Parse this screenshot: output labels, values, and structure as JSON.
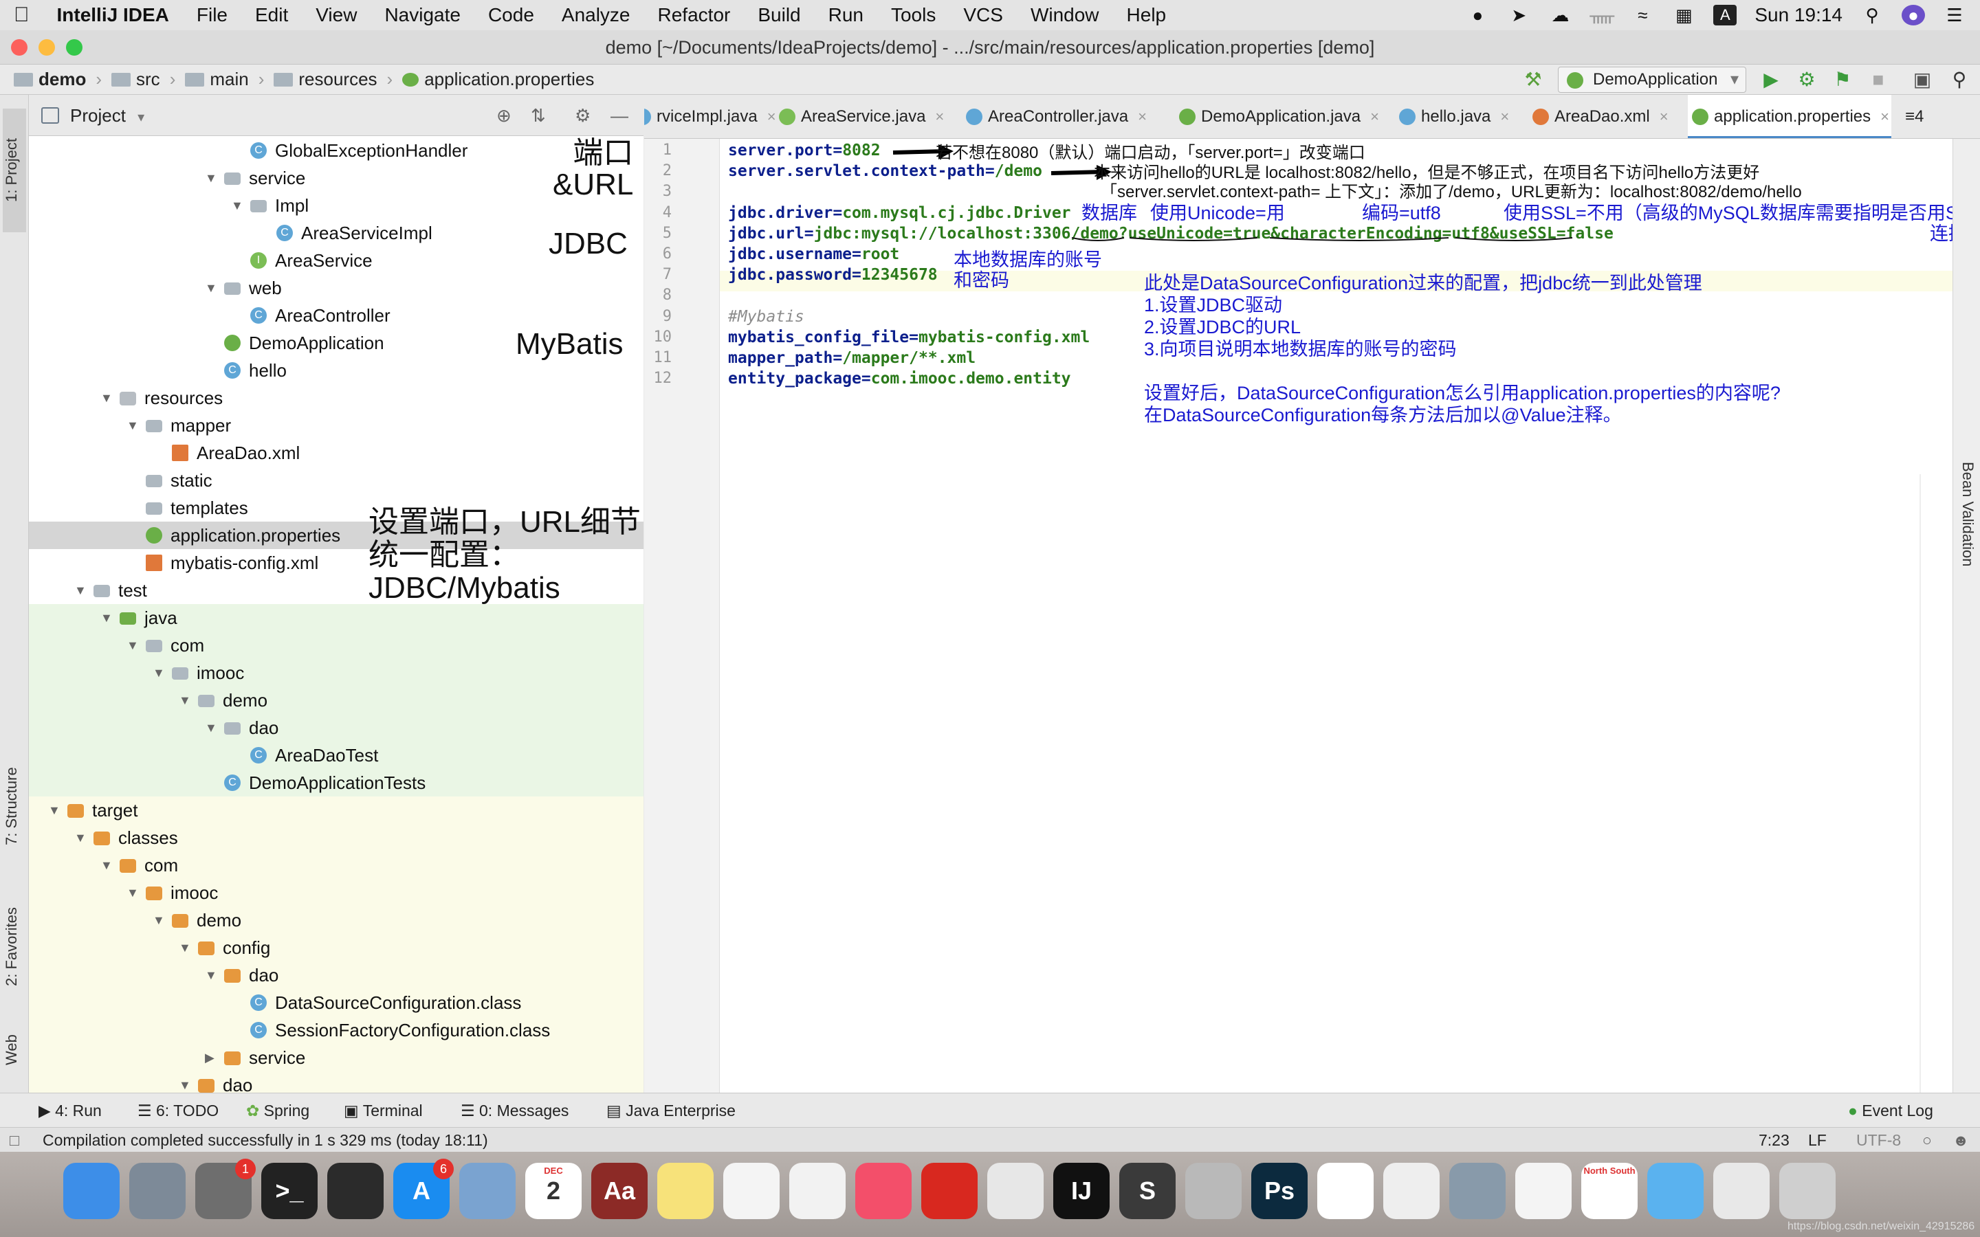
{
  "menubar": {
    "app": "IntelliJ IDEA",
    "items": [
      "File",
      "Edit",
      "View",
      "Navigate",
      "Code",
      "Analyze",
      "Refactor",
      "Build",
      "Run",
      "Tools",
      "VCS",
      "Window",
      "Help"
    ],
    "clock": "Sun 19:14",
    "input_source": "A"
  },
  "window": {
    "title": "demo [~/Documents/IdeaProjects/demo] - .../src/main/resources/application.properties [demo]"
  },
  "breadcrumb": [
    "demo",
    "src",
    "main",
    "resources",
    "application.properties"
  ],
  "run_config": "DemoApplication",
  "left_stripe": [
    "1: Project",
    "7: Structure",
    "2: Favorites",
    "Web"
  ],
  "project_panel": {
    "title": "Project"
  },
  "tree": [
    {
      "label": "GlobalExceptionHandler",
      "icon": "class-icon",
      "indent": 8,
      "arrow": ""
    },
    {
      "label": "service",
      "icon": "package-icon",
      "indent": 7,
      "arrow": "▼"
    },
    {
      "label": "Impl",
      "icon": "package-icon",
      "indent": 8,
      "arrow": "▼"
    },
    {
      "label": "AreaServiceImpl",
      "icon": "class-icon",
      "indent": 9,
      "arrow": ""
    },
    {
      "label": "AreaService",
      "icon": "interface-icon",
      "indent": 8,
      "arrow": ""
    },
    {
      "label": "web",
      "icon": "package-icon",
      "indent": 7,
      "arrow": "▼"
    },
    {
      "label": "AreaController",
      "icon": "class-icon",
      "indent": 8,
      "arrow": ""
    },
    {
      "label": "DemoApplication",
      "icon": "spring-class-icon",
      "indent": 7,
      "arrow": ""
    },
    {
      "label": "hello",
      "icon": "class-icon",
      "indent": 7,
      "arrow": ""
    },
    {
      "label": "resources",
      "icon": "resources-folder-icon",
      "indent": 3,
      "arrow": "▼"
    },
    {
      "label": "mapper",
      "icon": "package-icon",
      "indent": 4,
      "arrow": "▼"
    },
    {
      "label": "AreaDao.xml",
      "icon": "xml-file-icon",
      "indent": 5,
      "arrow": ""
    },
    {
      "label": "static",
      "icon": "package-icon",
      "indent": 4,
      "arrow": ""
    },
    {
      "label": "templates",
      "icon": "package-icon",
      "indent": 4,
      "arrow": ""
    },
    {
      "label": "application.properties",
      "icon": "spring-properties-icon",
      "indent": 4,
      "arrow": "",
      "state": "selected"
    },
    {
      "label": "mybatis-config.xml",
      "icon": "xml-file-icon",
      "indent": 4,
      "arrow": ""
    },
    {
      "label": "test",
      "icon": "package-icon",
      "indent": 2,
      "arrow": "▼"
    },
    {
      "label": "java",
      "icon": "green-folder-icon",
      "indent": 3,
      "arrow": "▼",
      "state": "test"
    },
    {
      "label": "com",
      "icon": "package-icon",
      "indent": 4,
      "arrow": "▼",
      "state": "test"
    },
    {
      "label": "imooc",
      "icon": "package-icon",
      "indent": 5,
      "arrow": "▼",
      "state": "test"
    },
    {
      "label": "demo",
      "icon": "package-icon",
      "indent": 6,
      "arrow": "▼",
      "state": "test"
    },
    {
      "label": "dao",
      "icon": "package-icon",
      "indent": 7,
      "arrow": "▼",
      "state": "test"
    },
    {
      "label": "AreaDaoTest",
      "icon": "class-icon",
      "indent": 8,
      "arrow": "",
      "state": "test"
    },
    {
      "label": "DemoApplicationTests",
      "icon": "class-icon",
      "indent": 7,
      "arrow": "",
      "state": "test"
    },
    {
      "label": "target",
      "icon": "orange-folder-icon",
      "indent": 1,
      "arrow": "▼",
      "state": "excluded"
    },
    {
      "label": "classes",
      "icon": "orange-folder-icon",
      "indent": 2,
      "arrow": "▼",
      "state": "excluded"
    },
    {
      "label": "com",
      "icon": "orange-folder-icon",
      "indent": 3,
      "arrow": "▼",
      "state": "excluded"
    },
    {
      "label": "imooc",
      "icon": "orange-folder-icon",
      "indent": 4,
      "arrow": "▼",
      "state": "excluded"
    },
    {
      "label": "demo",
      "icon": "orange-folder-icon",
      "indent": 5,
      "arrow": "▼",
      "state": "excluded"
    },
    {
      "label": "config",
      "icon": "orange-folder-icon",
      "indent": 6,
      "arrow": "▼",
      "state": "excluded"
    },
    {
      "label": "dao",
      "icon": "orange-folder-icon",
      "indent": 7,
      "arrow": "▼",
      "state": "excluded"
    },
    {
      "label": "DataSourceConfiguration.class",
      "icon": "class-icon",
      "indent": 8,
      "arrow": "",
      "state": "excluded"
    },
    {
      "label": "SessionFactoryConfiguration.class",
      "icon": "class-icon",
      "indent": 8,
      "arrow": "",
      "state": "excluded"
    },
    {
      "label": "service",
      "icon": "orange-folder-icon",
      "indent": 7,
      "arrow": "▶",
      "state": "excluded"
    },
    {
      "label": "dao",
      "icon": "orange-folder-icon",
      "indent": 6,
      "arrow": "▼",
      "state": "excluded"
    }
  ],
  "overlay_notes": {
    "port_url": "端口\n&URL",
    "jdbc": "JDBC",
    "mybatis": "MyBatis",
    "summary": "设置端口，URL细节\n统一配置：\nJDBC/Mybatis"
  },
  "tabs": [
    {
      "label": "rviceImpl.java",
      "icon": "class-icon"
    },
    {
      "label": "AreaService.java",
      "icon": "interface-icon"
    },
    {
      "label": "AreaController.java",
      "icon": "class-icon"
    },
    {
      "label": "DemoApplication.java",
      "icon": "spring-class-icon"
    },
    {
      "label": "hello.java",
      "icon": "class-icon"
    },
    {
      "label": "AreaDao.xml",
      "icon": "xml-file-icon"
    },
    {
      "label": "application.properties",
      "icon": "spring-properties-icon",
      "active": true
    }
  ],
  "tabs_more": "≡4",
  "code_lines": [
    {
      "n": "1",
      "key": "server.port",
      "val": "8082"
    },
    {
      "n": "2",
      "key": "server.servlet.context-path",
      "val": "/demo"
    },
    {
      "n": "3",
      "key": "",
      "val": ""
    },
    {
      "n": "4",
      "key": "jdbc.driver",
      "val": "com.mysql.cj.jdbc.Driver"
    },
    {
      "n": "5",
      "key": "jdbc.url",
      "val": "jdbc:mysql://localhost:3306/demo?useUnicode=true&characterEncoding=utf8&useSSL=false"
    },
    {
      "n": "6",
      "key": "jdbc.username",
      "val": "root"
    },
    {
      "n": "7",
      "key": "jdbc.password",
      "val": "12345678"
    },
    {
      "n": "8",
      "key": "",
      "val": ""
    },
    {
      "n": "9",
      "comment": "#Mybatis"
    },
    {
      "n": "10",
      "key": "mybatis_config_file",
      "val": "mybatis-config.xml"
    },
    {
      "n": "11",
      "key": "mapper_path",
      "val": "/mapper/**.xml"
    },
    {
      "n": "12",
      "key": "entity_package",
      "val": "com.imooc.demo.entity"
    }
  ],
  "annotations": {
    "a1": "若不想在8080（默认）端口启动，「server.port=」改变端口",
    "a2": "本来访问hello的URL是 localhost:8082/hello，但是不够正式，在项目名下访问hello方法更好",
    "a3": "「server.servlet.context-path= 上下文」：添加了/demo，URL更新为：localhost:8082/demo/hello",
    "db": "数据库",
    "unicode": "使用Unicode=用",
    "enc": "编码=utf8",
    "ssl": "使用SSL=不用（高级的MySQL数据库需要指明是否用SSL",
    "ssl2": "连接）",
    "acct1": "本地数据库的账号",
    "acct2": "和密码",
    "n1": "此处是DataSourceConfiguration过来的配置，把jdbc统一到此处管理",
    "n2": "1.设置JDBC驱动",
    "n3": "2.设置JDBC的URL",
    "n4": "3.向项目说明本地数据库的账号的密码",
    "n5": "设置好后，DataSourceConfiguration怎么引用application.properties的内容呢?",
    "n6": "在DataSourceConfiguration每条方法后加以@Value注释。"
  },
  "right_stripe": [
    "Bean Validation"
  ],
  "toolwindows": [
    "4: Run",
    "6: TODO",
    "Spring",
    "Terminal",
    "0: Messages",
    "Java Enterprise",
    "Event Log"
  ],
  "status": {
    "message": "Compilation completed successfully in 1 s 329 ms (today 18:11)",
    "position": "7:23",
    "line_sep": "LF",
    "encoding": "UTF-8"
  },
  "dock": [
    {
      "name": "finder",
      "color": "#3d8ee8"
    },
    {
      "name": "launchpad",
      "color": "#7d8a98"
    },
    {
      "name": "system-preferences",
      "color": "#6e6e6e",
      "badge": "1"
    },
    {
      "name": "terminal",
      "color": "#222222",
      "glyph": ">_"
    },
    {
      "name": "activity-monitor",
      "color": "#2b2b2b"
    },
    {
      "name": "app-store",
      "color": "#1a8cf0",
      "badge": "6",
      "glyph": "A"
    },
    {
      "name": "preview",
      "color": "#7aa3d0"
    },
    {
      "name": "calendar",
      "color": "#ffffff",
      "glyph": "2",
      "label": "DEC"
    },
    {
      "name": "dictionary",
      "color": "#8c2a26",
      "glyph": "Aa"
    },
    {
      "name": "notes",
      "color": "#f7e27a"
    },
    {
      "name": "reminders",
      "color": "#f4f4f4"
    },
    {
      "name": "photos",
      "color": "#f2f2f2"
    },
    {
      "name": "music",
      "color": "#f34f6a"
    },
    {
      "name": "netease-music",
      "color": "#d8281f"
    },
    {
      "name": "chrome",
      "color": "#e7e7e7"
    },
    {
      "name": "intellij",
      "color": "#111111",
      "glyph": "IJ"
    },
    {
      "name": "sublime",
      "color": "#3a3a3a",
      "glyph": "S"
    },
    {
      "name": "sequel",
      "color": "#b9b9b9"
    },
    {
      "name": "photoshop",
      "color": "#0c2a3e",
      "glyph": "Ps"
    },
    {
      "name": "baidu-netdisk",
      "color": "#ffffff"
    },
    {
      "name": "wechat",
      "color": "#eeeeee"
    },
    {
      "name": "image-capture",
      "color": "#889aaa"
    },
    {
      "name": "textedit",
      "color": "#f4f4f4"
    },
    {
      "name": "document",
      "color": "#ffffff",
      "label": "North South"
    },
    {
      "name": "folder",
      "color": "#5ab2ef"
    },
    {
      "name": "screenshot",
      "color": "#e8e8e8"
    },
    {
      "name": "trash",
      "color": "#cfcfcf"
    }
  ],
  "watermark": "https://blog.csdn.net/weixin_42915286",
  "colors": {
    "key": "#0c1f8c",
    "value": "#2b7a1b",
    "annotation": "#1a1ad0",
    "tab_underline": "#4a88c7",
    "test_bg": "#eaf6e5",
    "excluded_bg": "#fbfbe8"
  }
}
